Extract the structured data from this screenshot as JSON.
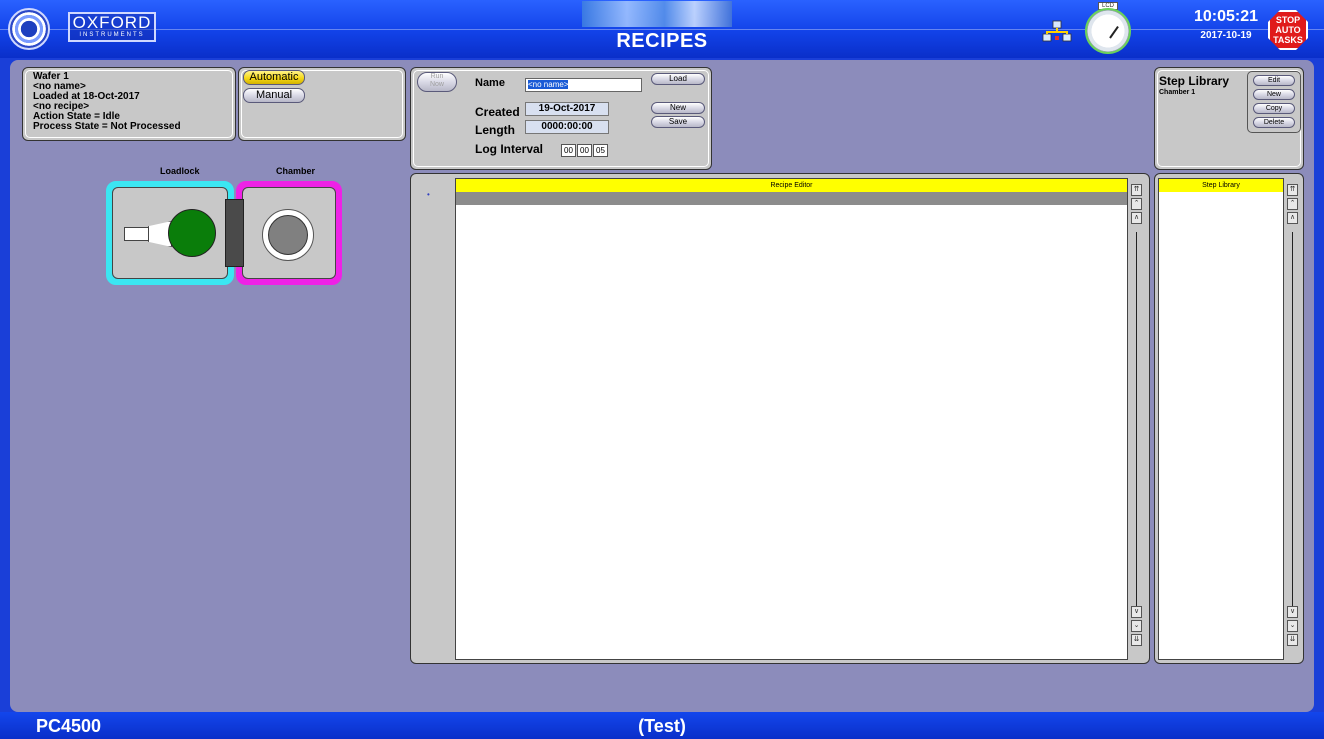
{
  "header": {
    "logo_text": "OXFORD",
    "logo_subtext": "INSTRUMENTS",
    "title": "RECIPES",
    "gauge_label": "LCD",
    "time": "10:05:21",
    "date": "2017-10-19",
    "stop_lines": [
      "STOP",
      "AUTO",
      "TASKS"
    ]
  },
  "wafer": {
    "lines": [
      "Wafer 1",
      "<no name>",
      "Loaded at 18-Oct-2017",
      "<no recipe>",
      "Action State  = Idle",
      "Process State = Not Processed"
    ]
  },
  "mode": {
    "automatic": "Automatic",
    "manual": "Manual",
    "selected": "Automatic"
  },
  "diagram": {
    "loadlock_label": "Loadlock",
    "chamber_label": "Chamber",
    "loadlock_color": "#3be6f2",
    "chamber_color": "#ee22e6",
    "wafer_color": "#0a7d0a"
  },
  "recipe": {
    "run_now": [
      "Run",
      "Now"
    ],
    "name_label": "Name",
    "name_value": "<no name>",
    "load": "Load",
    "created_label": "Created",
    "created_value": "19-Oct-2017",
    "length_label": "Length",
    "length_value": "0000:00:00",
    "log_interval_label": "Log Interval",
    "log_interval": [
      "00",
      "00",
      "05"
    ],
    "new": "New",
    "save": "Save"
  },
  "step_library_head": {
    "title": "Step Library",
    "subtitle": "Chamber 1",
    "edit": "Edit",
    "new": "New",
    "copy": "Copy",
    "delete": "Delete"
  },
  "editor": {
    "title": "Recipe Editor",
    "row_marker": "•"
  },
  "step_library_list": {
    "title": "Step Library"
  },
  "footer": {
    "left": "PC4500",
    "center": "(Test)"
  }
}
